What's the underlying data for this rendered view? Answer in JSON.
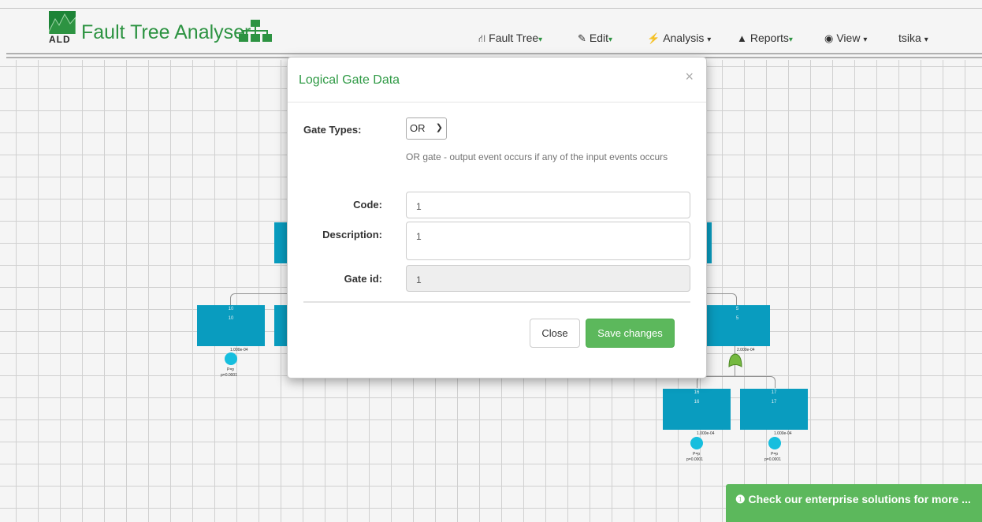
{
  "brand": {
    "logo_text": "ALD",
    "title": "Fault Tree Analyser"
  },
  "nav": {
    "fault_tree": "Fault Tree",
    "edit": "Edit",
    "analysis": "Analysis",
    "reports": "Reports",
    "view": "View",
    "user": "tsika"
  },
  "diagram": {
    "nodes": [
      {
        "id": "10",
        "label": "10",
        "prob_text": "1.000e-04",
        "event_label": "P=p",
        "p_text": "p=0.0001"
      },
      {
        "id": "5",
        "label": "5",
        "prob_text": "2.000e-04"
      },
      {
        "id": "16",
        "label": "16",
        "prob_text": "1.000e-04",
        "event_label": "P=p",
        "p_text": "p=0.0001"
      },
      {
        "id": "17",
        "label": "17",
        "prob_text": "1.000e-04",
        "event_label": "P=p",
        "p_text": "p=0.0001"
      }
    ],
    "gate_symbol": "OR"
  },
  "modal": {
    "title": "Logical Gate Data",
    "close_glyph": "×",
    "gate_types_label": "Gate Types:",
    "gate_type_value": "OR",
    "gate_help": "OR gate - output event occurs if any of the input events occurs",
    "code_label": "Code:",
    "code_value": "1",
    "description_label": "Description:",
    "description_value": "1",
    "gate_id_label": "Gate id:",
    "gate_id_value": "1",
    "close_button": "Close",
    "save_button": "Save changes"
  },
  "promo": {
    "text": "Check our enterprise solutions for more ..."
  },
  "colors": {
    "brand_green": "#2f9a45",
    "node_blue": "#0aa3c7",
    "save_green": "#5cb85c"
  }
}
